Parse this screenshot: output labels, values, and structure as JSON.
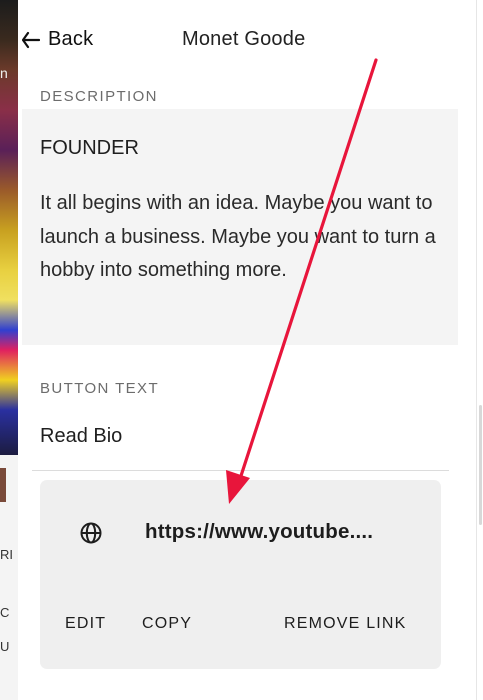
{
  "header": {
    "back_label": "Back",
    "title": "Monet Goode"
  },
  "description": {
    "section_label": "DESCRIPTION",
    "heading": "FOUNDER",
    "body": "It all begins with an idea. Maybe you want to launch a business. Maybe you want to turn a hobby into something more."
  },
  "button": {
    "section_label": "BUTTON TEXT",
    "value": "Read Bio"
  },
  "link": {
    "url_display": "https://www.youtube....",
    "actions": {
      "edit": "EDIT",
      "copy": "COPY",
      "remove": "REMOVE LINK"
    }
  },
  "background": {
    "glyphs": [
      "n",
      "RI",
      "C",
      "U"
    ]
  },
  "colors": {
    "annotation_arrow": "#e8153b",
    "card_background": "#efefef",
    "description_background": "#f4f4f4"
  },
  "icons": {
    "back": "back-arrow-icon",
    "link": "globe-icon"
  }
}
